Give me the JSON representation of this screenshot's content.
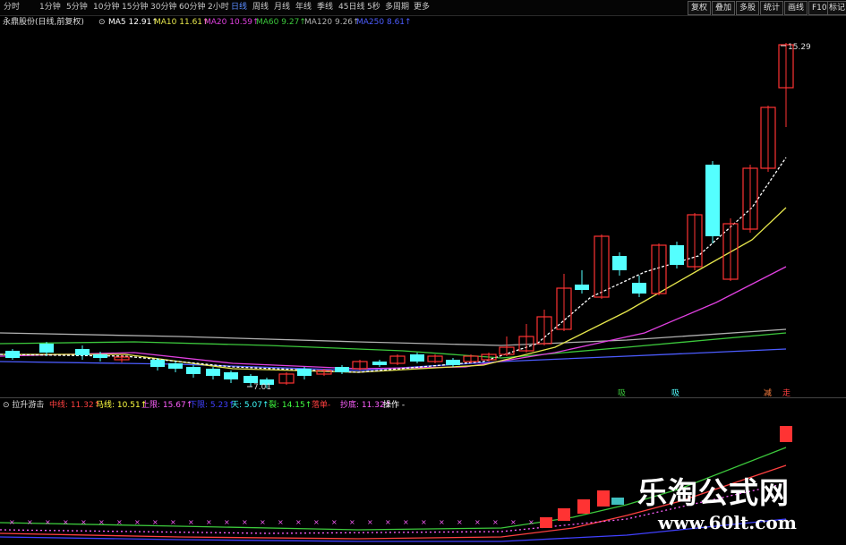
{
  "toolbar": {
    "tabs": [
      "分时",
      "1分钟",
      "5分钟",
      "10分钟",
      "15分钟",
      "30分钟",
      "60分钟",
      "2小时",
      "日线",
      "周线",
      "月线",
      "年线",
      "季线",
      "45日线",
      "5秒",
      "多周期",
      "更多"
    ],
    "active_tab": "日线",
    "buttons": [
      "复权",
      "叠加",
      "多股",
      "统计",
      "画线",
      "F10",
      "标记"
    ]
  },
  "main_indicator": {
    "title": "永鼎股份(日线,前复权)",
    "ma": [
      {
        "name": "MA5",
        "value": "12.91",
        "color": "#ffffff"
      },
      {
        "name": "MA10",
        "value": "11.61",
        "color": "#e6e64c"
      },
      {
        "name": "MA20",
        "value": "10.59",
        "color": "#e040e0"
      },
      {
        "name": "MA60",
        "value": "9.27",
        "color": "#3cc83c"
      },
      {
        "name": "MA120",
        "value": "9.26",
        "color": "#b0b0b0"
      },
      {
        "name": "MA250",
        "value": "8.61",
        "color": "#4c5cff"
      }
    ],
    "high_label": "15.29",
    "low_label": "7.01",
    "signals": [
      "吸",
      "吸",
      "减",
      "走"
    ]
  },
  "sub_indicator": {
    "title": "拉升游击",
    "items": [
      {
        "name": "中线",
        "value": "11.32",
        "color": "#ff4040"
      },
      {
        "name": "马线",
        "value": "10.51",
        "color": "#ffff40"
      },
      {
        "name": "上限",
        "value": "15.67",
        "color": "#ff60ff"
      },
      {
        "name": "下限",
        "value": "5.23",
        "color": "#4040ff"
      },
      {
        "name": "天",
        "value": "5.07",
        "color": "#40ffff"
      },
      {
        "name": "裂",
        "value": "14.15",
        "color": "#40ff40"
      },
      {
        "name": "落单",
        "value": "",
        "color": "#ff4040"
      },
      {
        "name": "抄底",
        "value": "11.32",
        "color": "#ff60ff"
      },
      {
        "name": "操作",
        "value": "",
        "color": "#ffffff"
      }
    ]
  },
  "watermark": {
    "line1": "乐淘公式网",
    "line2": "www.60lt.com"
  },
  "colors": {
    "up": "#ff3333",
    "down": "#54ffff",
    "background": "#000000"
  }
}
